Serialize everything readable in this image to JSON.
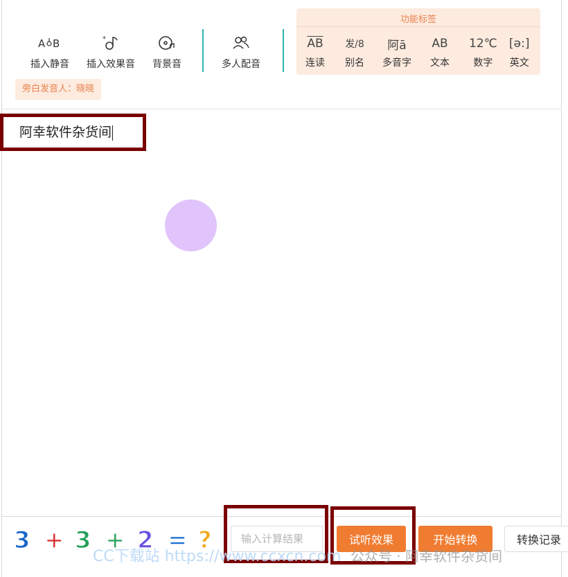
{
  "toolbar": {
    "insert_pause": "插入静音",
    "insert_effect": "插入效果音",
    "background_music": "背景音",
    "multi_voice": "多人配音"
  },
  "function_tags": {
    "title": "功能标签",
    "items": [
      {
        "label": "连读",
        "icon_text": "AB",
        "icon": "liaison-icon"
      },
      {
        "label": "别名",
        "icon_text": "发/8",
        "icon": "alias-icon"
      },
      {
        "label": "多音字",
        "icon_text": "阿ā",
        "icon": "polyphone-icon"
      },
      {
        "label": "文本",
        "icon_text": "AB",
        "icon": "text-icon"
      },
      {
        "label": "数字",
        "icon_text": "12℃",
        "icon": "number-icon"
      },
      {
        "label": "英文",
        "icon_text": "[ə:]",
        "icon": "english-icon"
      }
    ]
  },
  "narrator": "旁白发音人：晓晓",
  "editor": {
    "text": "阿幸软件杂货间"
  },
  "captcha": {
    "chars": [
      "3",
      "+",
      "3",
      "+",
      "2",
      "=",
      "?"
    ],
    "colors": [
      "#1a66c9",
      "#d92c2c",
      "#25a05a",
      "#25a05a",
      "#6b4fe0",
      "#1b6ed4",
      "#f2a81d"
    ]
  },
  "answer_input": {
    "placeholder": "输入计算结果",
    "value": ""
  },
  "buttons": {
    "preview": "试听效果",
    "start": "开始转换",
    "history": "转换记录"
  },
  "watermarks": {
    "site": "CC下载站 https://www.ccxcn.com",
    "wechat": "公众号 · 阿幸软件杂货间"
  },
  "colors": {
    "accent": "#f07c31",
    "tag_bg": "#fdebdf",
    "divider": "#2bb5b0",
    "highlight_box": "#7a0000",
    "circle": "#e0c4fb"
  }
}
